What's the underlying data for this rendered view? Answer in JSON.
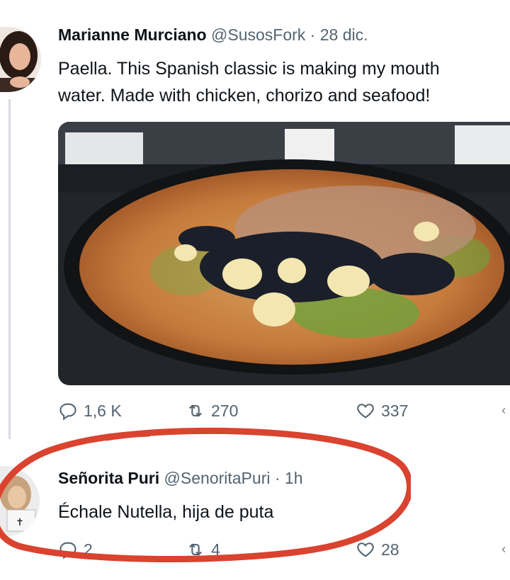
{
  "tweet": {
    "author_name": "Marianne Murciano",
    "handle": "@SusosFork",
    "separator": "·",
    "date": "28 dic.",
    "text_line1": "Paella. This Spanish classic is making my mouth",
    "text_line2": "water. Made with chicken, chorizo and seafood!",
    "replies": "1,6 K",
    "retweets": "270",
    "likes": "337"
  },
  "reply": {
    "author_name": "Señorita Puri",
    "handle": "@SenoritaPuri",
    "separator": "·",
    "time": "1h",
    "text": "Échale Nutella, hija de puta",
    "replies": "2",
    "retweets": "4",
    "likes": "28"
  },
  "colors": {
    "text": "#0f1419",
    "muted": "#536471",
    "annotation_ring": "#d9432f"
  }
}
